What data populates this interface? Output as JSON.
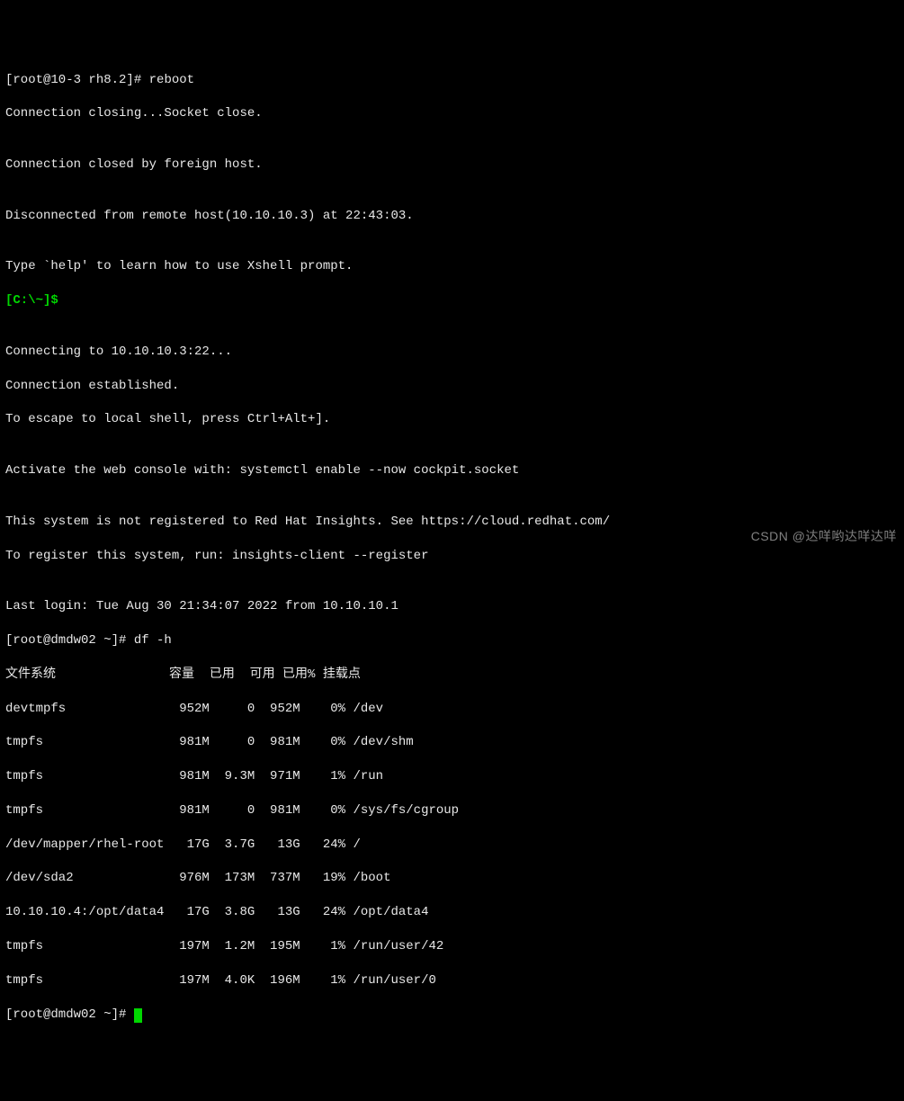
{
  "lines": {
    "l1_prompt": "[root@10-3 rh8.2]# ",
    "l1_cmd": "reboot",
    "l2": "Connection closing...Socket close.",
    "l3": "",
    "l4": "Connection closed by foreign host.",
    "l5": "",
    "l6": "Disconnected from remote host(10.10.10.3) at 22:43:03.",
    "l7": "",
    "l8": "Type `help' to learn how to use Xshell prompt.",
    "l9_prompt": "[C:\\~]$ ",
    "l10": "",
    "l11": "Connecting to 10.10.10.3:22...",
    "l12": "Connection established.",
    "l13": "To escape to local shell, press Ctrl+Alt+].",
    "l14": "",
    "l15": "Activate the web console with: systemctl enable --now cockpit.socket",
    "l16": "",
    "l17": "This system is not registered to Red Hat Insights. See https://cloud.redhat.com/",
    "l18": "To register this system, run: insights-client --register",
    "l19": "",
    "l20": "Last login: Tue Aug 30 21:34:07 2022 from 10.10.10.1",
    "l21_prompt": "[root@dmdw02 ~]# ",
    "l21_cmd": "df -h",
    "l22": "文件系统               容量  已用  可用 已用% 挂载点",
    "l23": "devtmpfs               952M     0  952M    0% /dev",
    "l24": "tmpfs                  981M     0  981M    0% /dev/shm",
    "l25": "tmpfs                  981M  9.3M  971M    1% /run",
    "l26": "tmpfs                  981M     0  981M    0% /sys/fs/cgroup",
    "l27": "/dev/mapper/rhel-root   17G  3.7G   13G   24% /",
    "l28": "/dev/sda2              976M  173M  737M   19% /boot",
    "l29": "10.10.10.4:/opt/data4   17G  3.8G   13G   24% /opt/data4",
    "l30": "tmpfs                  197M  1.2M  195M    1% /run/user/42",
    "l31": "tmpfs                  197M  4.0K  196M    1% /run/user/0",
    "l32_prompt": "[root@dmdw02 ~]# "
  },
  "chart_data": {
    "type": "table",
    "title": "df -h output",
    "columns": [
      "文件系统",
      "容量",
      "已用",
      "可用",
      "已用%",
      "挂载点"
    ],
    "rows": [
      [
        "devtmpfs",
        "952M",
        "0",
        "952M",
        "0%",
        "/dev"
      ],
      [
        "tmpfs",
        "981M",
        "0",
        "981M",
        "0%",
        "/dev/shm"
      ],
      [
        "tmpfs",
        "981M",
        "9.3M",
        "971M",
        "1%",
        "/run"
      ],
      [
        "tmpfs",
        "981M",
        "0",
        "981M",
        "0%",
        "/sys/fs/cgroup"
      ],
      [
        "/dev/mapper/rhel-root",
        "17G",
        "3.7G",
        "13G",
        "24%",
        "/"
      ],
      [
        "/dev/sda2",
        "976M",
        "173M",
        "737M",
        "19%",
        "/boot"
      ],
      [
        "10.10.10.4:/opt/data4",
        "17G",
        "3.8G",
        "13G",
        "24%",
        "/opt/data4"
      ],
      [
        "tmpfs",
        "197M",
        "1.2M",
        "195M",
        "1%",
        "/run/user/42"
      ],
      [
        "tmpfs",
        "197M",
        "4.0K",
        "196M",
        "1%",
        "/run/user/0"
      ]
    ]
  },
  "watermark": "CSDN @达咩哟达咩达咩"
}
